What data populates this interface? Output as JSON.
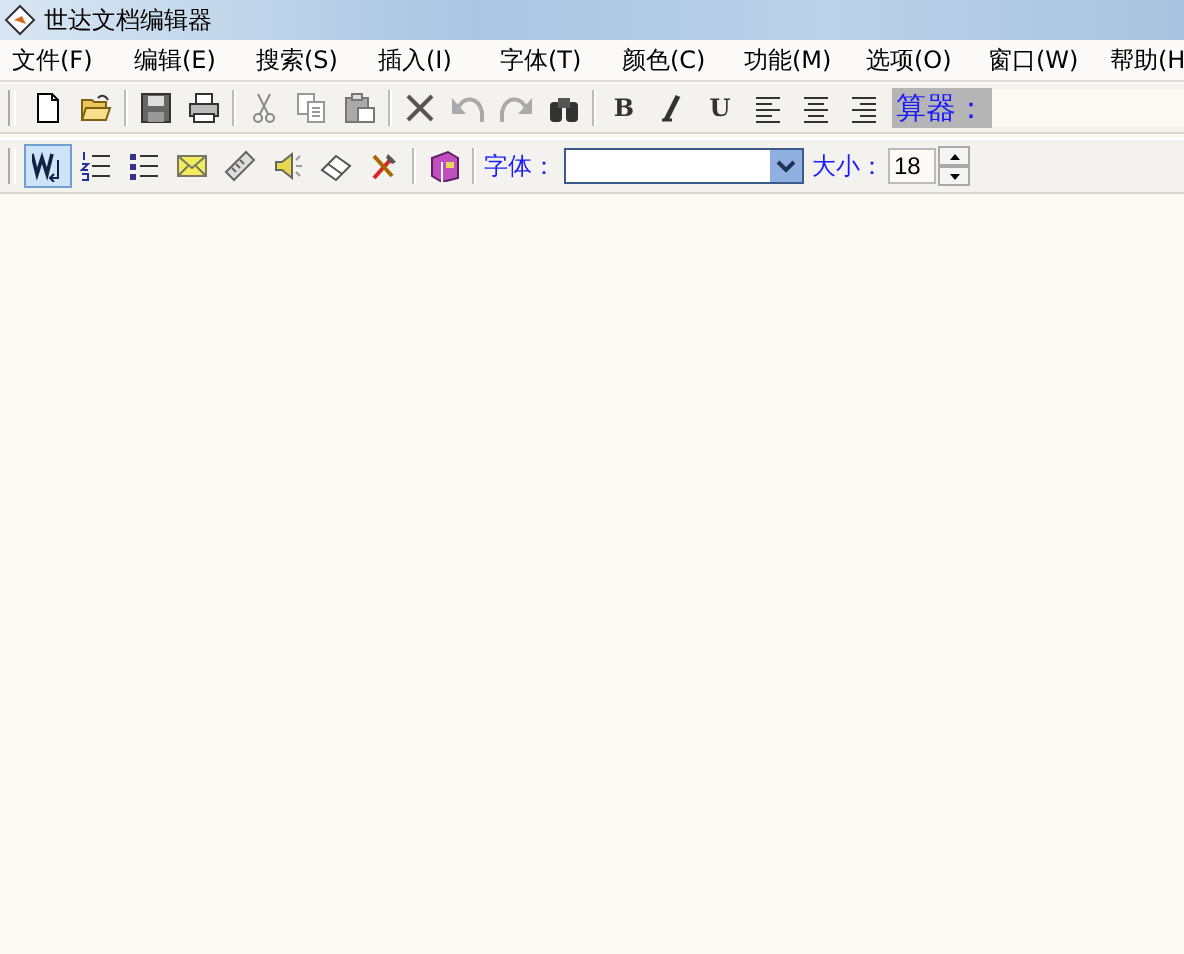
{
  "window": {
    "title": "世达文档编辑器"
  },
  "menu": [
    "文件(F)",
    "编辑(E)",
    "搜索(S)",
    "插入(I)",
    "字体(T)",
    "颜色(C)",
    "功能(M)",
    "选项(O)",
    "窗口(W)",
    "帮助(H"
  ],
  "toolbar": {
    "items": [
      {
        "kind": "icon"
      },
      {
        "kind": "icon"
      },
      {
        "kind": "icon"
      },
      {
        "kind": "icon"
      },
      {
        "kind": "icon"
      },
      {
        "kind": "icon"
      },
      {
        "kind": "icon"
      },
      {
        "kind": "icon"
      },
      {
        "kind": "icon"
      },
      {
        "kind": "icon"
      },
      {
        "kind": "icon"
      },
      {
        "kind": "letter",
        "text": "B"
      },
      {
        "kind": "icon"
      },
      {
        "kind": "letter",
        "text": "U"
      },
      {
        "kind": "icon"
      },
      {
        "kind": "icon"
      },
      {
        "kind": "icon"
      }
    ],
    "calculator_label": "算器："
  },
  "format_bar": {
    "buttons": [
      {
        "pressed": true
      },
      {
        "pressed": false
      },
      {
        "pressed": false
      },
      {
        "pressed": false
      },
      {
        "pressed": false
      },
      {
        "pressed": false
      },
      {
        "pressed": false
      },
      {
        "pressed": false
      },
      {
        "pressed": false
      }
    ],
    "font_label": "字体：",
    "size_label": "大小：",
    "size_value": "18"
  }
}
